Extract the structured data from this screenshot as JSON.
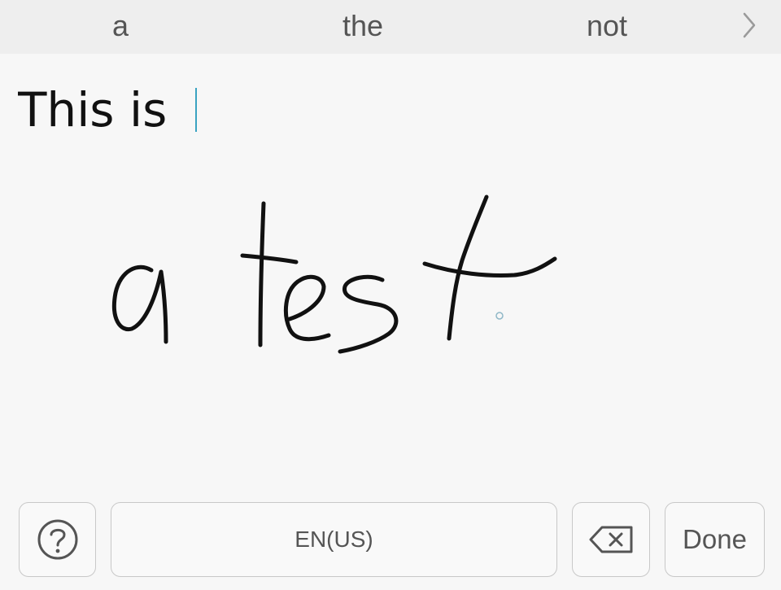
{
  "suggestions": {
    "items": [
      "a",
      "the",
      "not"
    ]
  },
  "editor": {
    "text": "This is",
    "handwriting": "a test"
  },
  "toolbar": {
    "language_label": "EN(US)",
    "done_label": "Done"
  },
  "colors": {
    "suggestion_bar": "#eeeeee",
    "background": "#f7f7f7",
    "caret": "#3aa3c2",
    "ink": "#111111",
    "button_border": "#c8c8c8"
  },
  "icons": {
    "help": "help-icon",
    "more": "chevron-right-icon",
    "backspace": "backspace-icon"
  }
}
